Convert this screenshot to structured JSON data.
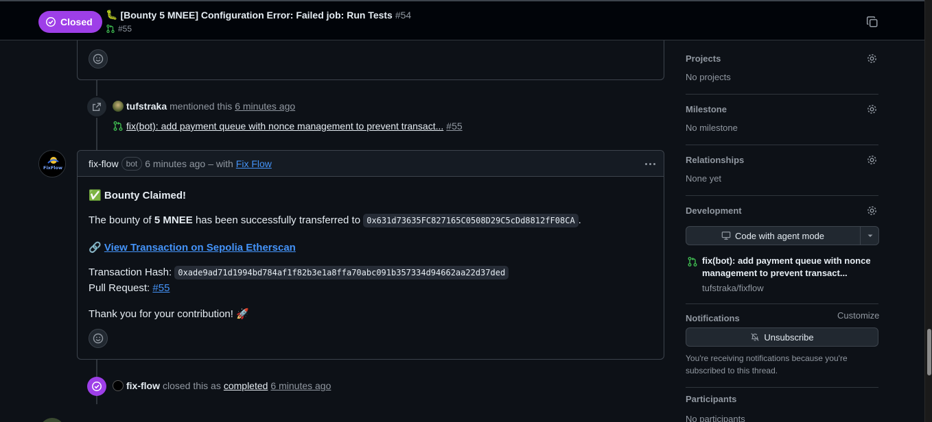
{
  "sticky": {
    "state": "Closed",
    "title": "[Bounty 5 MNEE] Configuration Error: Failed job: Run Tests",
    "number": "#54",
    "linked_pr": "#55"
  },
  "timeline": {
    "mention": {
      "user": "tufstraka",
      "text": "mentioned this",
      "time": "6 minutes ago",
      "pr_title": "fix(bot): add payment queue with nonce management to prevent transact...",
      "pr_number": "#55"
    },
    "comment": {
      "author": "fix-flow",
      "bot_label": "bot",
      "time": "6 minutes ago",
      "with_text": "– with",
      "app_link": "Fix Flow",
      "avatar_text": "FixFlow",
      "heading_emoji": "✅",
      "heading": "Bounty Claimed!",
      "line1_pre": "The bounty of",
      "line1_amount": "5 MNEE",
      "line1_post": "has been successfully transferred to",
      "address": "0x631d73635FC827165C0508D29C5cDd8812fF08CA",
      "line1_end": ".",
      "link_emoji": "🔗",
      "link_text": "View Transaction on Sepolia Etherscan",
      "hash_label": "Transaction Hash:",
      "hash_value": "0xade9ad71d1994bd784af1f82b3e1a8ffa70abc091b357334d94662aa22d37ded",
      "pr_label": "Pull Request:",
      "pr_link": "#55",
      "thanks": "Thank you for your contribution! 🚀"
    },
    "closed": {
      "user": "fix-flow",
      "text_pre": "closed this as",
      "reason": "completed",
      "time": "6 minutes ago"
    }
  },
  "sidebar": {
    "projects": {
      "label": "Projects",
      "value": "No projects"
    },
    "milestone": {
      "label": "Milestone",
      "value": "No milestone"
    },
    "relationships": {
      "label": "Relationships",
      "value": "None yet"
    },
    "development": {
      "label": "Development",
      "button": "Code with agent mode",
      "pr_title": "fix(bot): add payment queue with nonce management to prevent transact...",
      "pr_repo": "tufstraka/fixflow"
    },
    "notifications": {
      "label": "Notifications",
      "customize": "Customize",
      "button": "Unsubscribe",
      "note": "You're receiving notifications because you're subscribed to this thread."
    },
    "participants": {
      "label": "Participants",
      "value": "No participants"
    }
  },
  "colors": {
    "closed_purple": "#9e3fe8",
    "link_blue": "#4493f8",
    "pr_green": "#3fb950"
  }
}
